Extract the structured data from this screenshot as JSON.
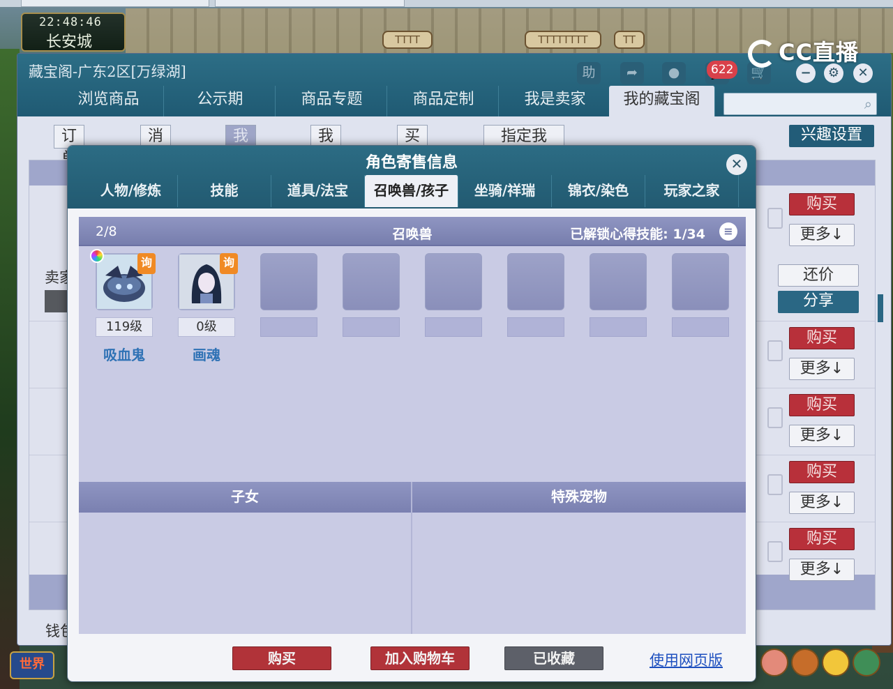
{
  "game": {
    "time": "22:48:46",
    "city": "长安城",
    "world_button": "世界",
    "tile_labels": [
      "TTTT",
      "TTTTTTTT",
      "TT"
    ]
  },
  "overlay": {
    "logo_text": "CC直播"
  },
  "main_window": {
    "title": "藏宝阁-广东2区[万绿湖]",
    "help_label": "助",
    "chat_count": "622",
    "nav": [
      "浏览商品",
      "公示期",
      "商品专题",
      "商品定制",
      "我是卖家",
      "我的藏宝阁"
    ],
    "active_nav": 5,
    "sub_tabs": [
      "订单管理",
      "消息提醒",
      "我的收藏",
      "我的兴趣",
      "买到物品",
      "指定我"
    ],
    "active_sub_tab": 2,
    "interest_button": "兴趣设置",
    "seller_label": "卖家",
    "money_label": "钱包",
    "buy_label": "购买",
    "more_label": "更多↓",
    "counter_offer_label": "还价",
    "share_label": "分享"
  },
  "modal": {
    "title": "角色寄售信息",
    "tabs": [
      "人物/修炼",
      "技能",
      "道具/法宝",
      "召唤兽/孩子",
      "坐骑/祥瑞",
      "锦衣/染色",
      "玩家之家"
    ],
    "active_tab": 3,
    "pets": {
      "count": "2/8",
      "title": "召唤兽",
      "skills_label": "已解锁心得技能: 1/34",
      "inquire_tag": "询",
      "items": [
        {
          "level": "119级",
          "name": "吸血鬼",
          "has_gem": true
        },
        {
          "level": "0级",
          "name": "画魂",
          "has_gem": false
        }
      ],
      "empty_slots": 6
    },
    "children_header": "子女",
    "special_pets_header": "特殊宠物",
    "buttons": {
      "buy": "购买",
      "add_to_cart": "加入购物车",
      "favorited": "已收藏",
      "web_version": "使用网页版"
    }
  },
  "colors": {
    "title_bar": "#225a71",
    "buy_red": "#b13339",
    "panel_purple": "#c9cbe4",
    "link_blue": "#1d4fbf"
  }
}
